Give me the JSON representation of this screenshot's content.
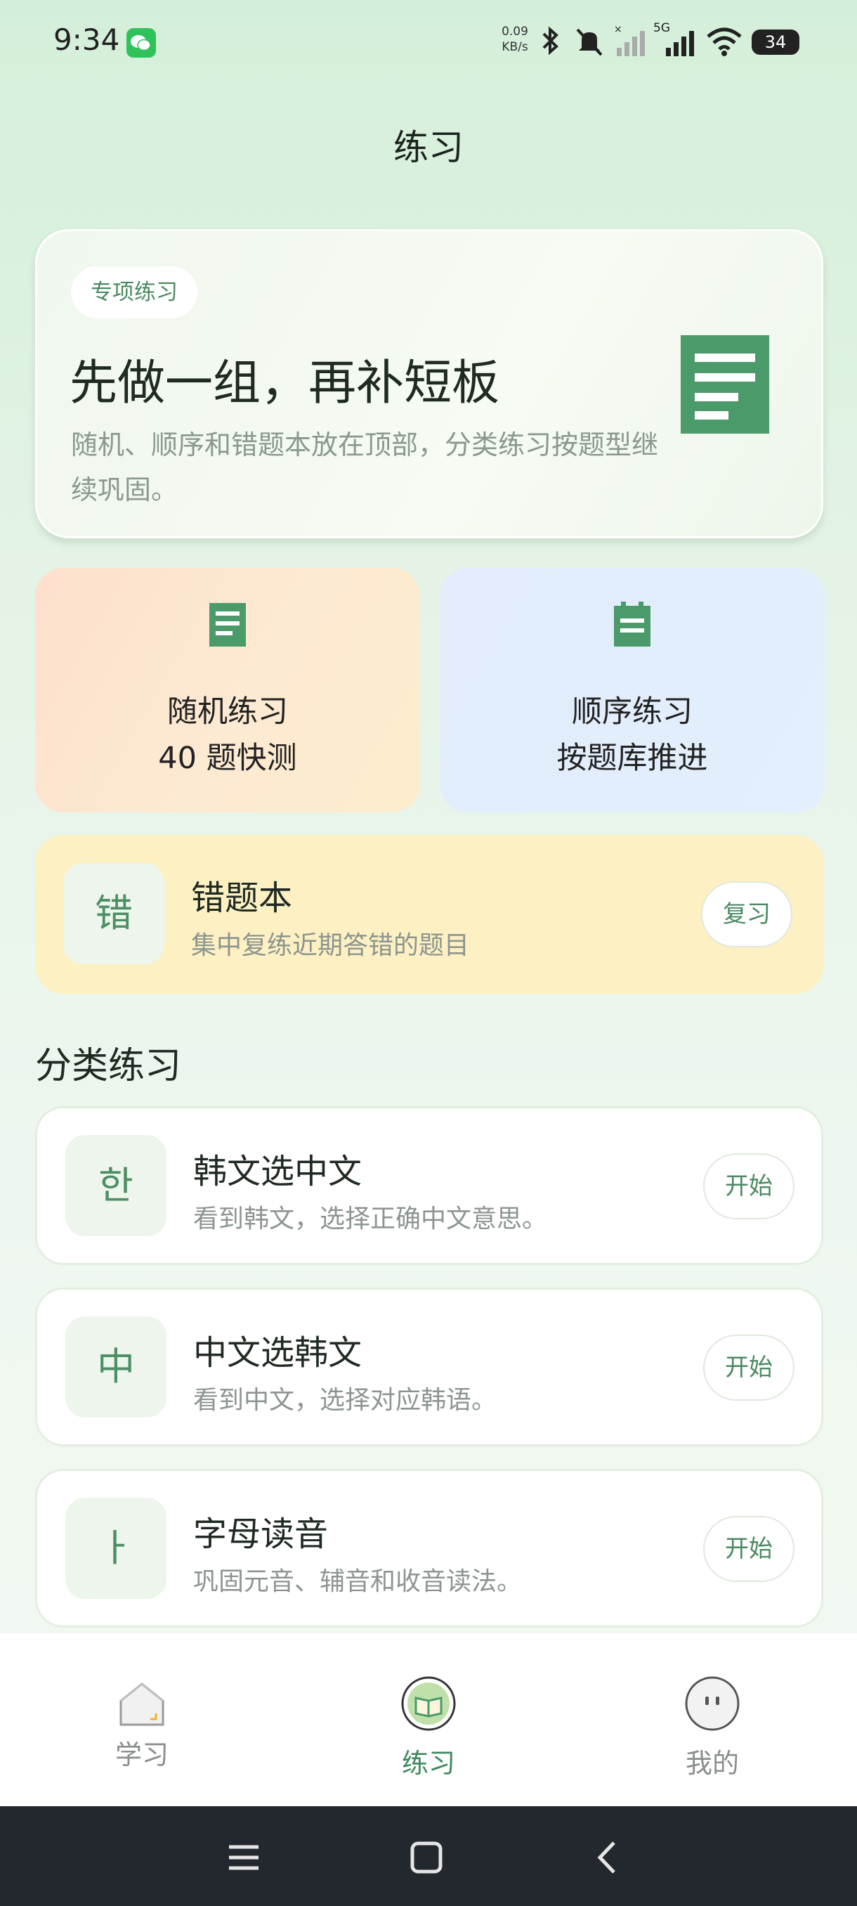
{
  "status": {
    "time": "9:34",
    "net_speed_value": "0.09",
    "net_speed_unit": "KB/s",
    "network_type": "5G",
    "battery": "34"
  },
  "header": {
    "title": "练习"
  },
  "hero": {
    "tag": "专项练习",
    "title": "先做一组，再补短板",
    "description": "随机、顺序和错题本放在顶部，分类练习按题型继续巩固。"
  },
  "quick": [
    {
      "title": "随机练习",
      "subtitle": "40 题快测"
    },
    {
      "title": "顺序练习",
      "subtitle": "按题库推进"
    }
  ],
  "mistake": {
    "icon_char": "错",
    "title": "错题本",
    "subtitle": "集中复练近期答错的题目",
    "button": "复习"
  },
  "category_section": {
    "title": "分类练习"
  },
  "categories": [
    {
      "icon_char": "한",
      "title": "韩文选中文",
      "subtitle": "看到韩文，选择正确中文意思。",
      "button": "开始"
    },
    {
      "icon_char": "中",
      "title": "中文选韩文",
      "subtitle": "看到中文，选择对应韩语。",
      "button": "开始"
    },
    {
      "icon_char": "ㅏ",
      "title": "字母读音",
      "subtitle": "巩固元音、辅音和收音读法。",
      "button": "开始"
    }
  ],
  "nav": {
    "items": [
      {
        "label": "学习",
        "icon": "home-icon"
      },
      {
        "label": "练习",
        "icon": "practice-book-icon",
        "active": true
      },
      {
        "label": "我的",
        "icon": "profile-icon"
      }
    ]
  },
  "colors": {
    "accent": "#3f8a5c",
    "doc_icon": "#4a9a6a",
    "random_card": "#fde4cf",
    "order_card": "#e2eefc",
    "mistake_card": "#fdf0c2",
    "system_bar": "#23272e"
  }
}
